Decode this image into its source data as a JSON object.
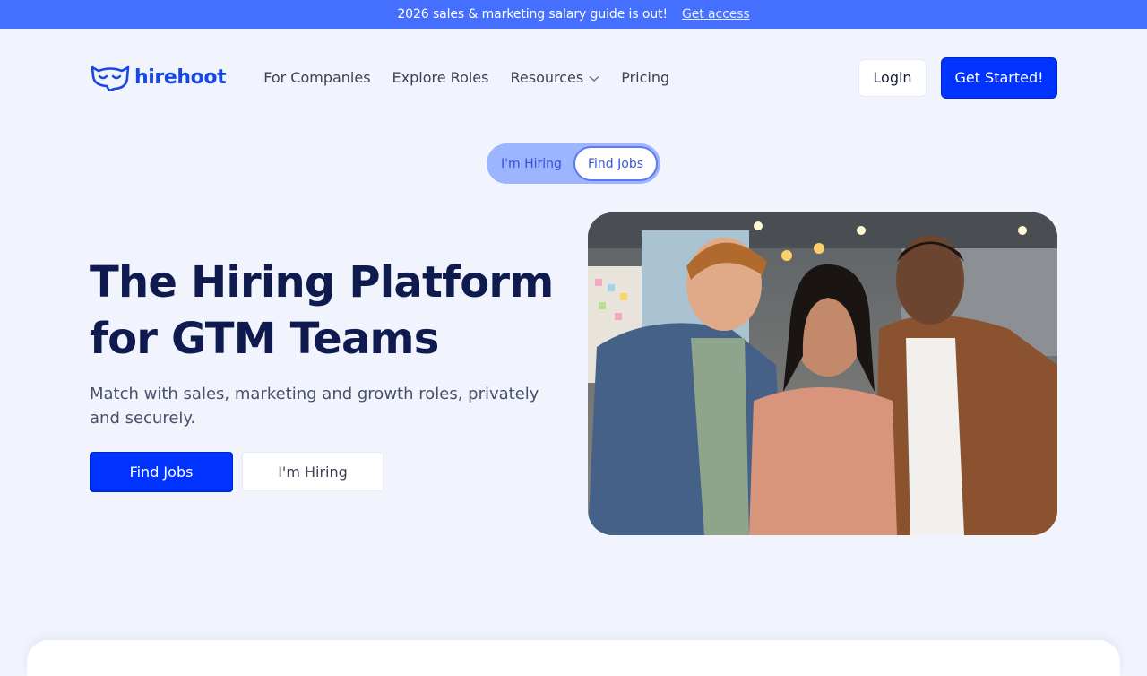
{
  "announcement": {
    "message": "2026 sales & marketing salary guide is out!",
    "link": "Get access"
  },
  "brand": {
    "name": "hirehoot",
    "color": "#1748e6"
  },
  "nav": {
    "items": [
      {
        "label": "For Companies"
      },
      {
        "label": "Explore Roles"
      },
      {
        "label": "Resources",
        "icon": "chevron-down-icon"
      },
      {
        "label": "Pricing"
      }
    ],
    "login": "Login",
    "cta": "Get Started!"
  },
  "toggle": {
    "options": [
      "I'm Hiring",
      "Find Jobs"
    ],
    "selected": "Find Jobs"
  },
  "hero": {
    "title_line1": "The Hiring Platform",
    "title_line2": "for GTM Teams",
    "subtitle": "Match with sales, marketing and growth roles, privately and securely.",
    "primary_button": "Find Jobs",
    "secondary_button": "I'm Hiring"
  },
  "colors": {
    "accent": "#0033ff",
    "banner": "#4570ff",
    "background": "#f1f4fd",
    "heading": "#0f1a4f"
  }
}
